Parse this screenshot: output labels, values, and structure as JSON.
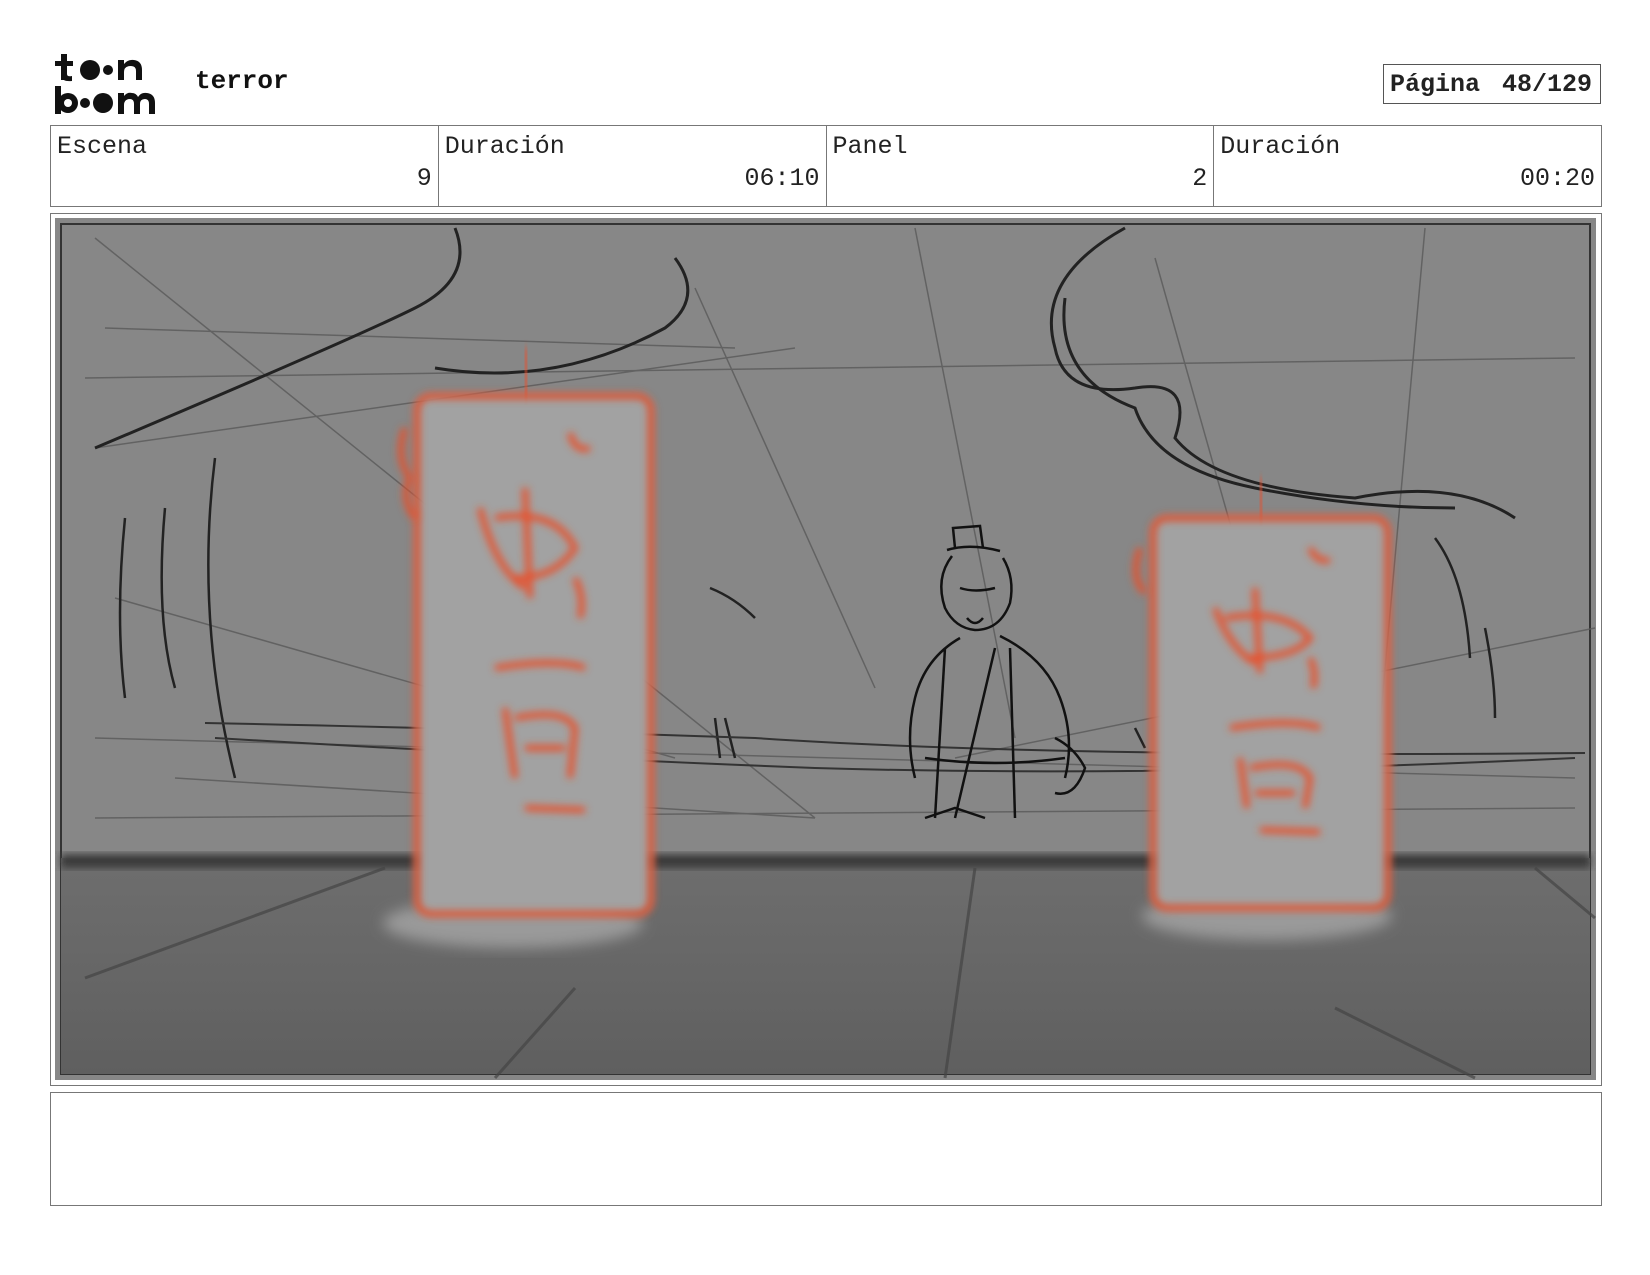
{
  "header": {
    "project_title": "terror",
    "page_label": "Página",
    "page_value": "48/129"
  },
  "info": {
    "scene_label": "Escena",
    "scene_value": "9",
    "scene_duration_label": "Duración",
    "scene_duration_value": "06:10",
    "panel_label": "Panel",
    "panel_value": "2",
    "panel_duration_label": "Duración",
    "panel_duration_value": "00:20"
  },
  "notes": {
    "text": ""
  },
  "colors": {
    "sketch_background": "#8a8a8a",
    "floor": "#6a6a6a",
    "lantern_fill": "#a8a8a8",
    "lantern_outline": "#e8502a",
    "ink": "#1a1a1a"
  }
}
